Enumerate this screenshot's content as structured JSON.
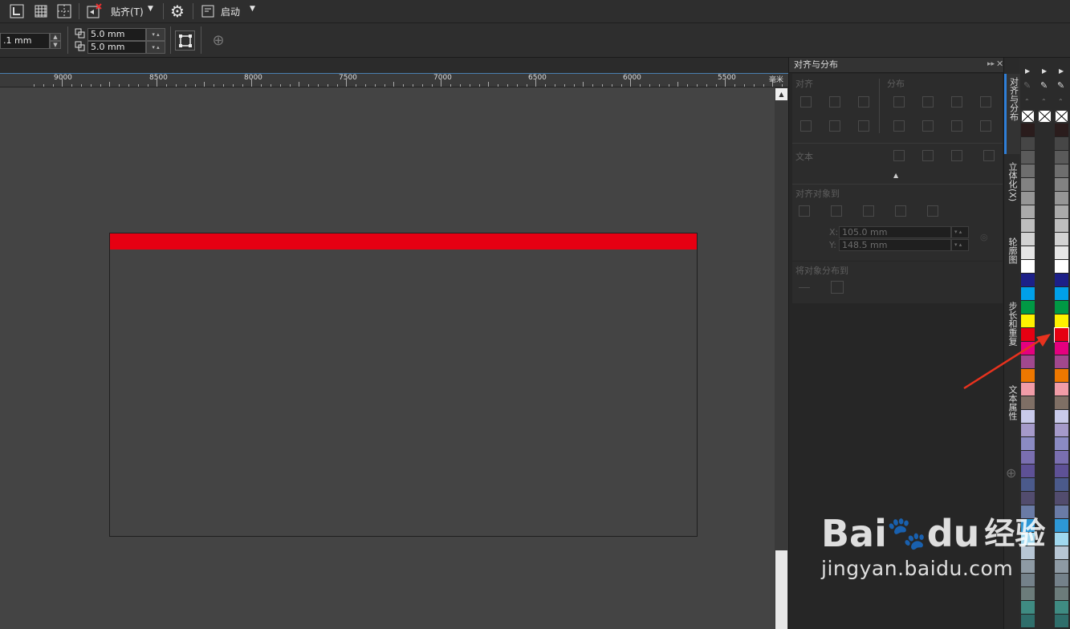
{
  "toolbar": {
    "snap_label": "贴齐(T)",
    "launch_label": "启动",
    "nudge_value": ".1 mm",
    "dup_x_value": "5.0 mm",
    "dup_y_value": "5.0 mm"
  },
  "ruler": {
    "labels": [
      "9000",
      "8500",
      "8000",
      "7500",
      "7000",
      "6500",
      "6000",
      "5500"
    ],
    "unit": "毫米"
  },
  "docker": {
    "title": "对齐与分布",
    "align_label": "对齐",
    "distribute_label": "分布",
    "text_label": "文本",
    "align_to_label": "对齐对象到",
    "x_label": "X:",
    "y_label": "Y:",
    "x_value": "105.0 mm",
    "y_value": "148.5 mm",
    "distribute_to_label": "将对象分布到"
  },
  "vtabs": [
    {
      "label": "对齐与分布"
    },
    {
      "label": "立体化(X)"
    },
    {
      "label": "轮廓图"
    },
    {
      "label": "步长和重复"
    },
    {
      "label": "文本属性"
    }
  ],
  "palette_colors": [
    "#2a1c1c",
    "#464646",
    "#5a5a5a",
    "#6e6e6e",
    "#828282",
    "#969696",
    "#aaaaaa",
    "#bebebe",
    "#d2d2d2",
    "#e6e6e6",
    "#ffffff",
    "#1d2088",
    "#00a0e9",
    "#009944",
    "#fff100",
    "#e60012",
    "#e4007f",
    "#a1488e",
    "#ee7800",
    "#f19ca7",
    "#7f6f65",
    "#c9caea",
    "#a59aca",
    "#8b8bc3",
    "#7a6fb0",
    "#5e5196",
    "#4b5a8b",
    "#524c6e",
    "#6a7ba6",
    "#2d97d6",
    "#a0d8ef",
    "#b7c6d4",
    "#8e9aa4",
    "#74818a",
    "#6c7c7b",
    "#3f8b82",
    "#2f6e6b"
  ],
  "watermark": {
    "brand": "Bai",
    "brand2": "du",
    "cn": "经验",
    "url": "jingyan.baidu.com"
  }
}
